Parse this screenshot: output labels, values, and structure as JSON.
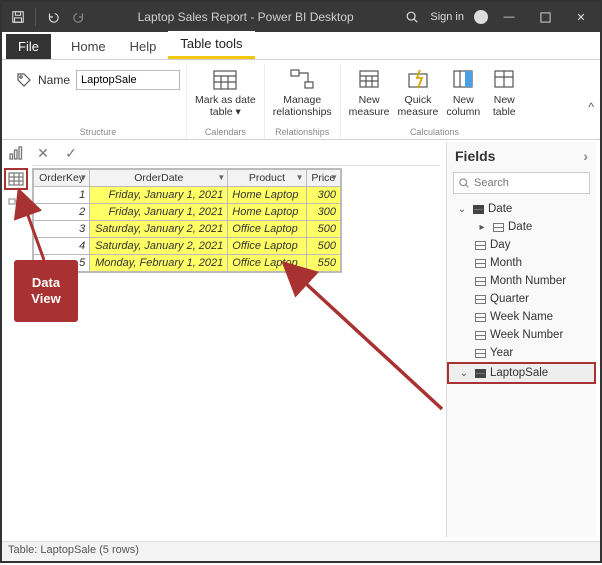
{
  "titlebar": {
    "title": "Laptop Sales Report - Power BI Desktop",
    "signin_label": "Sign in"
  },
  "ribbon": {
    "tabs": {
      "file": "File",
      "home": "Home",
      "help": "Help",
      "table_tools": "Table tools"
    },
    "name_label": "Name",
    "name_value": "LaptopSale",
    "groups": {
      "structure": "Structure",
      "calendars": "Calendars",
      "relationships": "Relationships",
      "calculations": "Calculations"
    },
    "buttons": {
      "mark_date": "Mark as date\ntable",
      "manage_rel": "Manage\nrelationships",
      "new_measure": "New\nmeasure",
      "quick_measure": "Quick\nmeasure",
      "new_column": "New\ncolumn",
      "new_table": "New\ntable"
    }
  },
  "grid": {
    "columns": [
      "OrderKey",
      "OrderDate",
      "Product",
      "Price"
    ],
    "rows": [
      {
        "idx": "1",
        "date": "Friday, January 1, 2021",
        "product": "Home Laptop",
        "price": "300"
      },
      {
        "idx": "2",
        "date": "Friday, January 1, 2021",
        "product": "Home Laptop",
        "price": "300"
      },
      {
        "idx": "3",
        "date": "Saturday, January 2, 2021",
        "product": "Office Laptop",
        "price": "500"
      },
      {
        "idx": "4",
        "date": "Saturday, January 2, 2021",
        "product": "Office Laptop",
        "price": "500"
      },
      {
        "idx": "5",
        "date": "Monday, February 1, 2021",
        "product": "Office Laptop",
        "price": "550"
      }
    ]
  },
  "fields": {
    "title": "Fields",
    "search_placeholder": "Search",
    "tables": {
      "date": {
        "label": "Date",
        "children": [
          "Date",
          "Day",
          "Month",
          "Month Number",
          "Quarter",
          "Week Name",
          "Week Number",
          "Year"
        ]
      },
      "laptopsale": {
        "label": "LaptopSale"
      }
    }
  },
  "callout": {
    "text": "Data\nView"
  },
  "status": {
    "text": "Table: LaptopSale (5 rows)"
  }
}
